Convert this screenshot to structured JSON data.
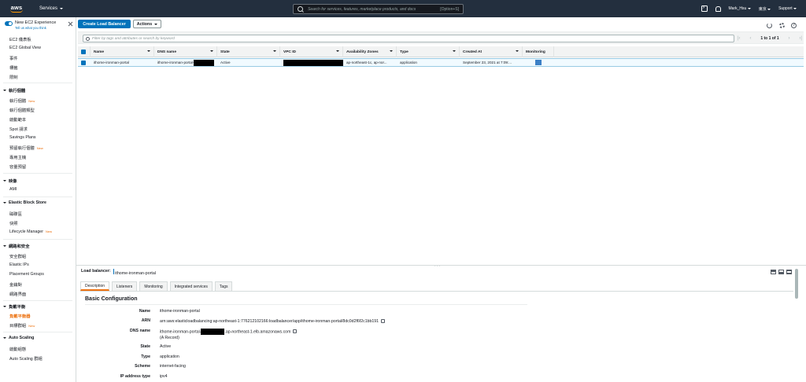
{
  "topnav": {
    "logo_text": "aws",
    "services_label": "Services",
    "search_placeholder": "Search for services, features, marketplace products, and docs",
    "search_shortcut": "[Option+S]",
    "user": "Mark_Hsu",
    "region": "東京",
    "support": "Support"
  },
  "sidebar": {
    "experience_title": "New EC2 Experience",
    "experience_sub": "Tell us what you think",
    "top_items": [
      "EC2 儀表板",
      "EC2 Global View",
      "事件",
      "標籤",
      "限制"
    ],
    "sections": [
      {
        "title": "執行個體",
        "items": [
          {
            "label": "執行個體",
            "new": "New"
          },
          {
            "label": "執行個體類型",
            "new": ""
          },
          {
            "label": "啟動範本",
            "new": ""
          },
          {
            "label": "Spot 請求",
            "new": ""
          },
          {
            "label": "Savings Plans",
            "new": ""
          },
          {
            "label": "預留執行個體",
            "new": "New"
          },
          {
            "label": "專用主機",
            "new": ""
          },
          {
            "label": "容量預留",
            "new": ""
          }
        ]
      },
      {
        "title": "映像",
        "items": [
          {
            "label": "AMI",
            "new": ""
          }
        ]
      },
      {
        "title": "Elastic Block Store",
        "items": [
          {
            "label": "磁碟區",
            "new": ""
          },
          {
            "label": "快照",
            "new": ""
          },
          {
            "label": "Lifecycle Manager",
            "new": "New"
          }
        ]
      },
      {
        "title": "網路和安全",
        "items": [
          {
            "label": "安全群組",
            "new": ""
          },
          {
            "label": "Elastic IPs",
            "new": ""
          },
          {
            "label": "Placement Groups",
            "new": ""
          },
          {
            "label": "金鑰對",
            "new": ""
          },
          {
            "label": "網路界面",
            "new": ""
          }
        ]
      },
      {
        "title": "負載平衡",
        "items": [
          {
            "label": "負載平衡器",
            "new": "",
            "active": true
          },
          {
            "label": "目標群組",
            "new": "New"
          }
        ]
      },
      {
        "title": "Auto Scaling",
        "items": [
          {
            "label": "啟動組態",
            "new": ""
          },
          {
            "label": "Auto Scaling 群組",
            "new": ""
          }
        ]
      }
    ]
  },
  "toolbar": {
    "create_label": "Create Load Balancer",
    "actions_label": "Actions"
  },
  "filter": {
    "placeholder": "Filter by tags and attributes or search by keyword",
    "pagination": "1 to 1 of 1"
  },
  "table": {
    "columns": [
      "Name",
      "DNS name",
      "State",
      "VPC ID",
      "Availability Zones",
      "Type",
      "Created At",
      "Monitoring"
    ],
    "row": {
      "name": "ithome-ironman-portal",
      "dns": "ithome-ironman-portal-",
      "state": "Active",
      "az": "ap-northeast-1c, ap-nor...",
      "type": "application",
      "created": "September 23, 2021 at 7:09:..."
    }
  },
  "details": {
    "title_label": "Load balancer:",
    "title_value": "ithome-ironman-portal",
    "tabs": [
      "Description",
      "Listeners",
      "Monitoring",
      "Integrated services",
      "Tags"
    ],
    "section": "Basic Configuration",
    "fields": {
      "name_label": "Name",
      "name_value": "ithome-ironman-portal",
      "arn_label": "ARN",
      "arn_value": "arn:aws:elasticloadbalancing:ap-northeast-1:776212102166:loadbalancer/app/ithome-ironman-portal/8dc0d2f6f2c1bb191",
      "dns_label": "DNS name",
      "dns_value_pre": "ithome-ironman-portal-",
      "dns_value_post": ".ap-northeast-1.elb.amazonaws.com",
      "dns_record": "(A Record)",
      "state_label": "State",
      "state_value": "Active",
      "type_label": "Type",
      "type_value": "application",
      "scheme_label": "Scheme",
      "scheme_value": "internet-facing",
      "ip_label": "IP address type",
      "ip_value": "ipv4"
    }
  }
}
